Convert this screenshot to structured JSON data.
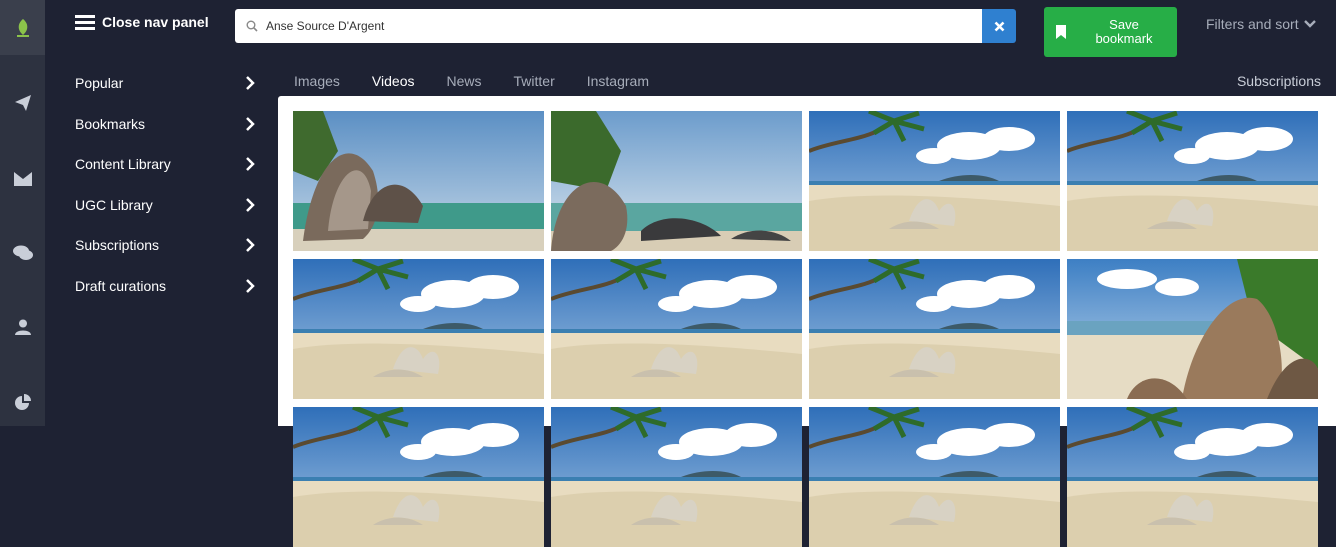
{
  "rail": {
    "icons": [
      "leaf-logo-icon",
      "paper-plane-icon",
      "envelope-icon",
      "chat-bubbles-icon",
      "user-icon",
      "pie-chart-icon"
    ]
  },
  "nav": {
    "toggle_label": "Close nav panel",
    "items": [
      {
        "label": "Popular"
      },
      {
        "label": "Bookmarks"
      },
      {
        "label": "Content Library"
      },
      {
        "label": "UGC Library"
      },
      {
        "label": "Subscriptions"
      },
      {
        "label": "Draft curations"
      }
    ]
  },
  "search": {
    "value": "Anse Source D'Argent"
  },
  "save_button": {
    "label_line1": "Save",
    "label_line2": "bookmark"
  },
  "filters": {
    "label": "Filters and sort"
  },
  "tabs": [
    {
      "label": "Images"
    },
    {
      "label": "Videos",
      "active": true
    },
    {
      "label": "News"
    },
    {
      "label": "Twitter"
    },
    {
      "label": "Instagram"
    }
  ],
  "subscriptions_label": "Subscriptions",
  "colors": {
    "rail_bg": "#2d3240",
    "nav_bg": "#1e2233",
    "accent_blue": "#2f80d0",
    "save_green": "#27ae47",
    "logo_green": "#8bc34a"
  },
  "thumbnails": [
    {
      "scene": "boulders-ocean"
    },
    {
      "scene": "boulders-ocean-wide"
    },
    {
      "scene": "palm-beach-coral"
    },
    {
      "scene": "palm-beach-coral"
    },
    {
      "scene": "palm-beach-coral"
    },
    {
      "scene": "palm-beach-coral"
    },
    {
      "scene": "palm-beach-coral"
    },
    {
      "scene": "beach-boulder-right"
    },
    {
      "scene": "palm-beach-coral"
    },
    {
      "scene": "palm-beach-coral"
    },
    {
      "scene": "palm-beach-coral"
    },
    {
      "scene": "palm-beach-coral"
    }
  ]
}
